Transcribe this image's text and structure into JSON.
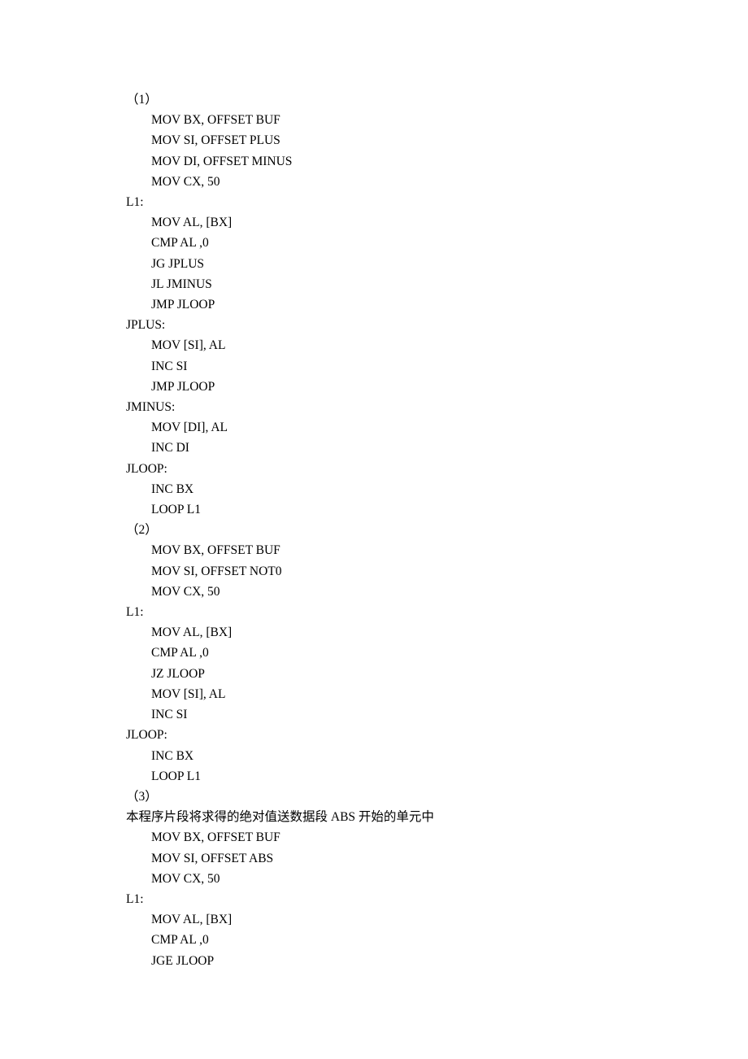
{
  "lines": [
    "（1）",
    "        MOV BX, OFFSET BUF",
    "        MOV SI, OFFSET PLUS",
    "        MOV DI, OFFSET MINUS",
    "        MOV CX, 50",
    "L1:",
    "        MOV AL, [BX]",
    "        CMP AL ,0",
    "        JG JPLUS",
    "        JL JMINUS",
    "        JMP JLOOP",
    "JPLUS:",
    "        MOV [SI], AL",
    "        INC SI",
    "        JMP JLOOP",
    "JMINUS:",
    "        MOV [DI], AL",
    "        INC DI",
    "JLOOP:",
    "        INC BX",
    "        LOOP L1",
    "",
    "（2）",
    "        MOV BX, OFFSET BUF",
    "        MOV SI, OFFSET NOT0",
    "        MOV CX, 50",
    "L1:",
    "        MOV AL, [BX]",
    "        CMP AL ,0",
    "        JZ JLOOP",
    "        MOV [SI], AL",
    "        INC SI",
    "JLOOP:",
    "        INC BX",
    "        LOOP L1",
    "（3）",
    "本程序片段将求得的绝对值送数据段 ABS 开始的单元中",
    "        MOV BX, OFFSET BUF",
    "        MOV SI, OFFSET ABS",
    "        MOV CX, 50",
    "L1:",
    "        MOV AL, [BX]",
    "        CMP AL ,0",
    "        JGE JLOOP"
  ]
}
